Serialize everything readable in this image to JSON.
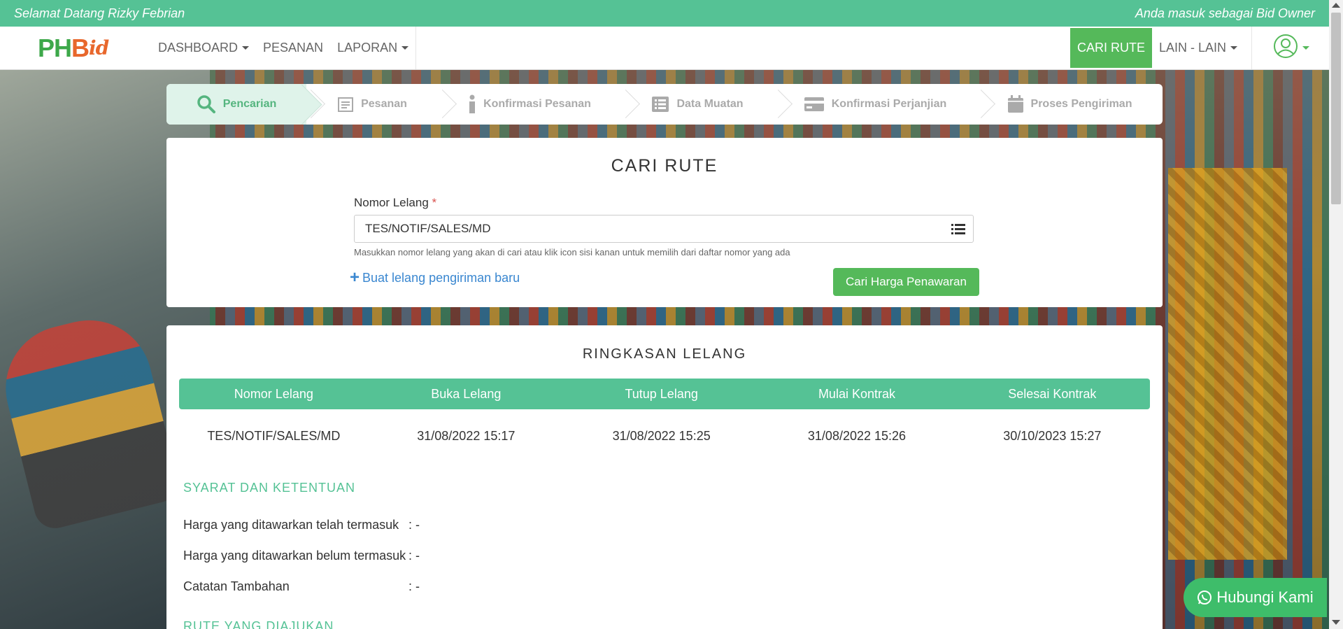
{
  "topbar": {
    "welcome": "Selamat Datang Rizky Febrian",
    "role": "Anda masuk sebagai Bid Owner"
  },
  "logo": {
    "part1": "PH",
    "part2": "B",
    "part3": "id"
  },
  "nav": {
    "dashboard": "DASHBOARD",
    "pesanan": "PESANAN",
    "laporan": "LAPORAN",
    "cari_rute": "CARI RUTE",
    "lain": "LAIN - LAIN"
  },
  "wizard": {
    "steps": [
      {
        "label": "Pencarian",
        "icon": "search-icon",
        "active": true
      },
      {
        "label": "Pesanan",
        "icon": "calendar-list-icon",
        "active": false
      },
      {
        "label": "Konfirmasi Pesanan",
        "icon": "info-icon",
        "active": false
      },
      {
        "label": "Data Muatan",
        "icon": "list-alt-icon",
        "active": false
      },
      {
        "label": "Konfirmasi Perjanjian",
        "icon": "credit-card-icon",
        "active": false
      },
      {
        "label": "Proses Pengiriman",
        "icon": "calendar-icon",
        "active": false
      }
    ]
  },
  "search": {
    "title": "CARI RUTE",
    "label": "Nomor Lelang",
    "required_mark": "*",
    "value": "TES/NOTIF/SALES/MD",
    "help": "Masukkan nomor lelang yang akan di cari atau klik icon sisi kanan untuk memilih dari daftar nomor yang ada",
    "new_link": "Buat lelang pengiriman baru",
    "submit": "Cari Harga Penawaran"
  },
  "summary": {
    "title": "RINGKASAN LELANG",
    "columns": [
      "Nomor Lelang",
      "Buka Lelang",
      "Tutup Lelang",
      "Mulai Kontrak",
      "Selesai Kontrak"
    ],
    "rows": [
      [
        "TES/NOTIF/SALES/MD",
        "31/08/2022 15:17",
        "31/08/2022 15:25",
        "31/08/2022 15:26",
        "30/10/2023 15:27"
      ]
    ],
    "terms_title": "SYARAT DAN KETENTUAN",
    "terms": [
      {
        "k": "Harga yang ditawarkan telah termasuk",
        "v": ": -"
      },
      {
        "k": "Harga yang ditawarkan belum termasuk",
        "v": ": -"
      },
      {
        "k": "Catatan Tambahan",
        "v": ": -"
      }
    ],
    "rute_title": "RUTE YANG DIAJUKAN"
  },
  "whatsapp": {
    "label": "Hubungi Kami"
  },
  "colors": {
    "brand_green": "#55c295",
    "button_green": "#55b95a",
    "link_blue": "#3a87d0",
    "required_red": "#d9534f"
  }
}
